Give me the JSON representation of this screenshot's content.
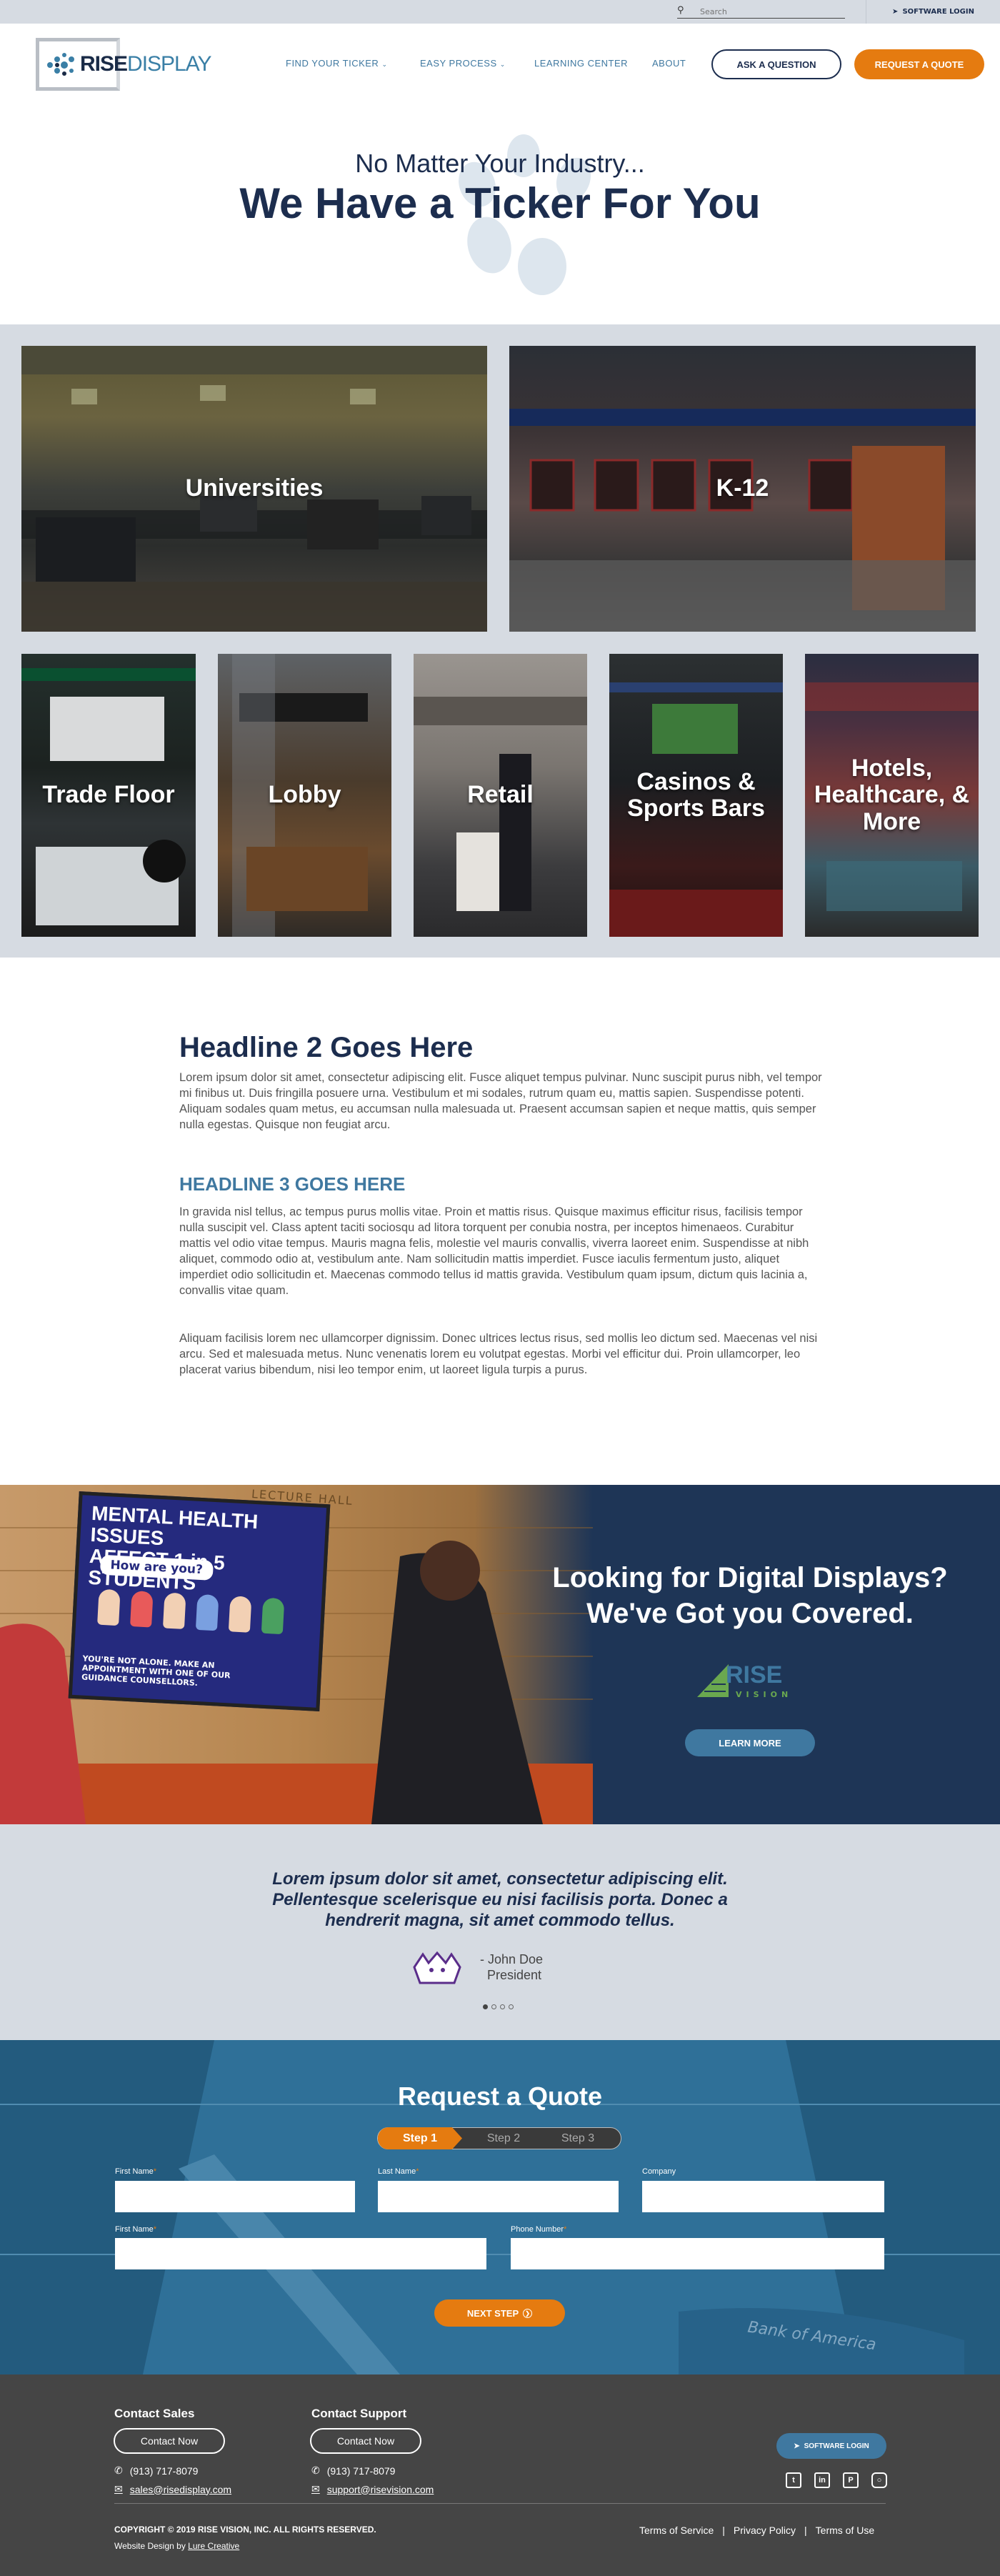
{
  "topbar": {
    "search_placeholder": "Search",
    "software_login": "SOFTWARE LOGIN"
  },
  "logo": {
    "rise": "RISE",
    "display": "DISPLAY"
  },
  "nav": [
    {
      "label": "FIND YOUR TICKER",
      "dropdown": true
    },
    {
      "label": "EASY PROCESS",
      "dropdown": true
    },
    {
      "label": "LEARNING CENTER",
      "dropdown": false
    },
    {
      "label": "ABOUT",
      "dropdown": false
    }
  ],
  "header_buttons": {
    "ask": "ASK A QUESTION",
    "quote": "REQUEST A QUOTE"
  },
  "hero": {
    "subtitle": "No Matter Your Industry...",
    "title": "We Have a Ticker For You"
  },
  "industries": {
    "universities": "Universities",
    "k12": "K-12",
    "trade_floor": "Trade Floor",
    "lobby": "Lobby",
    "retail": "Retail",
    "casinos": "Casinos & Sports Bars",
    "hotels": "Hotels, Healthcare, & More"
  },
  "content": {
    "h2": "Headline 2 Goes Here",
    "p1": "Lorem ipsum dolor sit amet, consectetur adipiscing elit. Fusce aliquet tempus pulvinar. Nunc suscipit purus nibh, vel tempor mi finibus ut. Duis fringilla posuere urna. Vestibulum et mi sodales, rutrum quam eu, mattis sapien. Suspendisse potenti. Aliquam sodales quam metus, eu accumsan nulla malesuada ut. Praesent accumsan sapien et neque mattis, quis semper nulla egestas. Quisque non feugiat arcu.",
    "h3": "HEADLINE 3 GOES HERE",
    "p2": "In gravida nisl tellus, ac tempus purus mollis vitae. Proin et mattis risus. Quisque maximus efficitur risus, facilisis tempor nulla suscipit vel. Class aptent taciti sociosqu ad litora torquent per conubia nostra, per inceptos himenaeos. Curabitur mattis vel odio vitae tempus. Mauris magna felis, molestie vel mauris convallis, viverra laoreet enim. Suspendisse at nibh aliquet, commodo odio at, vestibulum ante. Nam sollicitudin mattis imperdiet. Fusce iaculis fermentum justo, aliquet imperdiet odio sollicitudin et. Maecenas commodo tellus id mattis gravida. Vestibulum quam ipsum, dictum quis lacinia a, convallis vitae quam.",
    "p3": "Aliquam facilisis lorem nec ullamcorper dignissim. Donec ultrices lectus risus, sed mollis leo dictum sed. Maecenas vel nisi arcu. Sed et malesuada metus. Nunc venenatis lorem eu volutpat egestas. Morbi vel efficitur dui. Proin ullamcorper, leo placerat varius bibendum, nisi leo tempor enim, ut laoreet ligula turpis a purus."
  },
  "promo": {
    "screen_line1": "MENTAL HEALTH ISSUES",
    "screen_line2": "AFFECT 1 in 5 STUDENTS",
    "screen_question": "How are you?",
    "screen_footer": "YOU'RE NOT ALONE. MAKE AN APPOINTMENT WITH ONE OF OUR GUIDANCE COUNSELLORS.",
    "wall_text": "LECTURE HALL",
    "title_line1": "Looking for Digital Displays?",
    "title_line2": "We've Got you Covered.",
    "brand_rise": "RISE",
    "brand_vision": "VISION",
    "learn_more": "LEARN MORE"
  },
  "testimonial": {
    "quote": "Lorem ipsum dolor sit amet, consectetur adipiscing elit. Pellentesque scelerisque eu nisi facilisis porta. Donec a hendrerit magna, sit amet commodo tellus.",
    "name": "- John Doe",
    "role": "President",
    "active_dot": 0,
    "dots": 4
  },
  "quote_form": {
    "title": "Request a Quote",
    "steps": [
      "Step 1",
      "Step 2",
      "Step 3"
    ],
    "labels": {
      "first_name": "First Name",
      "last_name": "Last Name",
      "company": "Company",
      "first_name_2": "First Name",
      "phone": "Phone Number"
    },
    "next": "NEXT STEP",
    "bg_sign": "Bank of America"
  },
  "footer": {
    "sales_heading": "Contact Sales",
    "support_heading": "Contact Support",
    "contact_now": "Contact Now",
    "sales_phone": "(913) 717-8079",
    "sales_email": "sales@risedisplay.com",
    "support_phone": "(913) 717-8079",
    "support_email": "support@risevision.com",
    "software_login": "SOFTWARE LOGIN",
    "copyright": "COPYRIGHT © 2019 RISE VISION, INC. ALL RIGHTS RESERVED.",
    "credit_prefix": "Website Design by",
    "credit_link": "Lure Creative",
    "links": [
      "Terms of Service",
      "Privacy Policy",
      "Terms of Use"
    ]
  },
  "colors": {
    "navy": "#1c2d4e",
    "blue": "#3f78a0",
    "orange": "#e57b10",
    "gray_bg": "#d6dbe2",
    "footer": "#454545"
  }
}
